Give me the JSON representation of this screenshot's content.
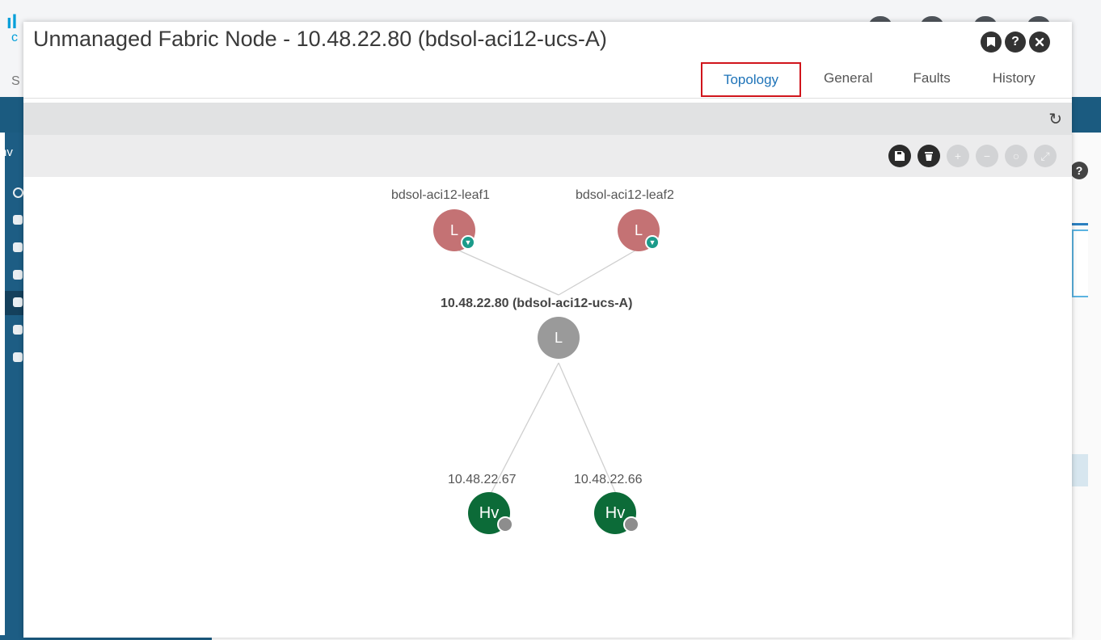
{
  "modal": {
    "title": "Unmanaged Fabric Node - 10.48.22.80 (bdsol-aci12-ucs-A)",
    "header_icons": [
      "bookmark-icon",
      "help-icon",
      "close-icon"
    ],
    "tabs": [
      {
        "label": "Topology",
        "selected": true
      },
      {
        "label": "General",
        "selected": false
      },
      {
        "label": "Faults",
        "selected": false
      },
      {
        "label": "History",
        "selected": false
      }
    ],
    "toolbar_icons": [
      "save-icon",
      "delete-icon",
      "zoom-in-icon",
      "zoom-out-icon",
      "reset-icon",
      "fit-icon"
    ]
  },
  "topology": {
    "leaf_nodes": [
      {
        "name": "bdsol-aci12-leaf1",
        "glyph": "L"
      },
      {
        "name": "bdsol-aci12-leaf2",
        "glyph": "L"
      }
    ],
    "center_node": {
      "name": "10.48.22.80 (bdsol-aci12-ucs-A)",
      "glyph": "L"
    },
    "hypervisors": [
      {
        "name": "10.48.22.67",
        "glyph": "Hv"
      },
      {
        "name": "10.48.22.66",
        "glyph": "Hv"
      }
    ]
  },
  "colors": {
    "accent": "#1e73b8",
    "tab_highlight": "#d0151c",
    "leaf": "#c47274",
    "unmanaged": "#9a9a9a",
    "hypervisor": "#0c6b38",
    "badge": "#1b9b8a"
  },
  "background": {
    "logo_letter": "c",
    "left_letter": "S",
    "sidebar_fragment": "nv",
    "help_glyph": "?"
  }
}
